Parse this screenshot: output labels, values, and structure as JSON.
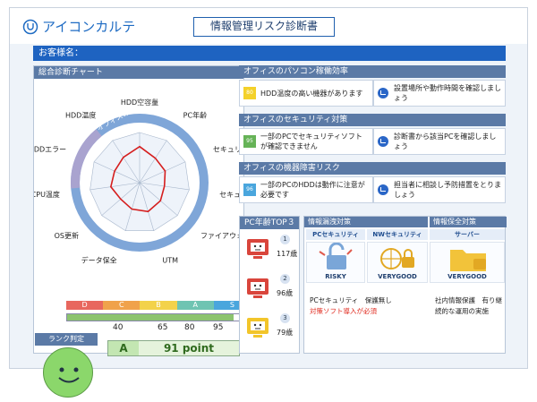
{
  "app": {
    "logo_text": "アイコンカルテ",
    "doc_title": "情報管理リスク診断書",
    "customer_label": "お客様名："
  },
  "overall": {
    "header": "総合診断チャート",
    "rank_letters": [
      "D",
      "C",
      "B",
      "A",
      "S"
    ],
    "rank_colors": [
      "#e8675e",
      "#f0a24b",
      "#f3d24a",
      "#6fc4b2",
      "#4aa6dd"
    ],
    "progress_pct": 91,
    "ticks": [
      "40",
      "65",
      "80",
      "95"
    ],
    "rank_title": "ランク判定",
    "grade": "A",
    "point": "91 point"
  },
  "chart_data": {
    "type": "radar",
    "axes": [
      "HDD空容量",
      "PC年齢",
      "セキュリティソフト",
      "セキュリティソフト更新",
      "ファイアウォール",
      "UTM",
      "データ保全",
      "OS更新",
      "CPU温度",
      "HDDエラー",
      "HDD温度"
    ],
    "values": [
      0.72,
      0.58,
      0.56,
      0.5,
      0.55,
      0.6,
      0.55,
      0.5,
      0.58,
      0.55,
      0.6
    ],
    "ring_labels": [
      "オフィスのパソコン稼働率",
      "オフィスのセキュリティ",
      "オフィスの機器障害リスク"
    ]
  },
  "sections": [
    {
      "title": "オフィスのパソコン稼働効率",
      "score": "80",
      "score_color": "#f4d12a",
      "finding": "HDD温度の高い機器があります",
      "advice": "設置場所や動作時間を確認しましょう"
    },
    {
      "title": "オフィスのセキュリティ対策",
      "score": "95",
      "score_color": "#66b357",
      "finding": "一部のPCでセキュリティソフトが確認できません",
      "advice": "診断書から該当PCを確認しましょう"
    },
    {
      "title": "オフィスの機器障害リスク",
      "score": "96",
      "score_color": "#4aa6dd",
      "finding": "一部のPCのHDDは動作に注意が必要です",
      "advice": "担当者に相談し予防措置をとりましょう"
    }
  ],
  "pc_age": {
    "header": "PC年齢TOP３",
    "items": [
      {
        "rank": "1",
        "age": "117歳",
        "color": "#d9453c"
      },
      {
        "rank": "2",
        "age": "96歳",
        "color": "#d9453c"
      },
      {
        "rank": "3",
        "age": "79歳",
        "color": "#f2c52a"
      }
    ]
  },
  "leak": {
    "header": "情報漏洩対策",
    "col1": "PCセキュリティ",
    "col2": "NWセキュリティ",
    "illus1": "RISKY",
    "illus2": "VERYGOOD",
    "status1": "PCセキュリティ　保護無し",
    "status2": "対策ソフト導入が必須"
  },
  "protect": {
    "header": "情報保全対策",
    "col": "サーバー",
    "illus": "VERYGOOD",
    "status": "社内情報保護　有り継続的な運用の実施"
  }
}
